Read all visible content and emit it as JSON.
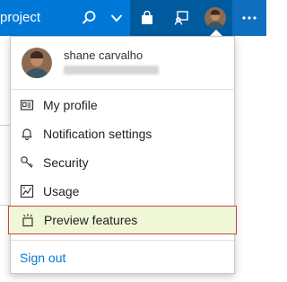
{
  "topbar": {
    "project_label": "project",
    "icons": [
      "search-icon",
      "chevron-down-icon",
      "marketplace-bag-icon",
      "feedback-icon",
      "avatar",
      "more-icon"
    ]
  },
  "user": {
    "name": "shane carvalho"
  },
  "menu": {
    "items": [
      {
        "label": "My profile",
        "icon": "profile-card-icon"
      },
      {
        "label": "Notification settings",
        "icon": "bell-icon"
      },
      {
        "label": "Security",
        "icon": "key-icon"
      },
      {
        "label": "Usage",
        "icon": "usage-chart-icon"
      },
      {
        "label": "Preview features",
        "icon": "preview-features-icon"
      }
    ],
    "highlighted_index": 4,
    "sign_out": "Sign out"
  },
  "colors": {
    "topbar": "#0078d7",
    "link": "#0078d7",
    "highlight_fill": "#eff7d7",
    "highlight_border": "#c54545"
  }
}
